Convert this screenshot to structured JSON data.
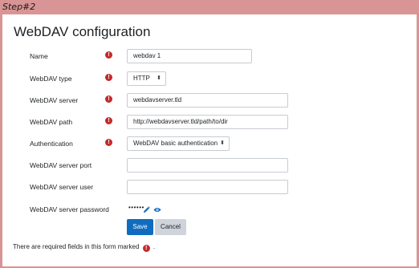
{
  "step": {
    "label": "Step#2"
  },
  "page": {
    "title": "WebDAV configuration"
  },
  "form": {
    "name": {
      "label": "Name",
      "value": "webdav 1"
    },
    "type": {
      "label": "WebDAV type",
      "value": "HTTP"
    },
    "server": {
      "label": "WebDAV server",
      "value": "webdavserver.tld"
    },
    "path": {
      "label": "WebDAV path",
      "value": "http://webdavserver.tld/path/to/dir"
    },
    "auth": {
      "label": "Authentication",
      "value": "WebDAV basic authentication"
    },
    "port": {
      "label": "WebDAV server port",
      "value": ""
    },
    "user": {
      "label": "WebDAV server user",
      "value": ""
    },
    "password": {
      "label": "WebDAV server password",
      "masked": "••••••"
    },
    "required_icon": "!"
  },
  "buttons": {
    "save": "Save",
    "cancel": "Cancel"
  },
  "footer": {
    "before": "There are required fields in this form marked",
    "after": "."
  },
  "colors": {
    "primary": "#0f6cbf",
    "required": "#c22b2b",
    "frame": "#d89494"
  }
}
